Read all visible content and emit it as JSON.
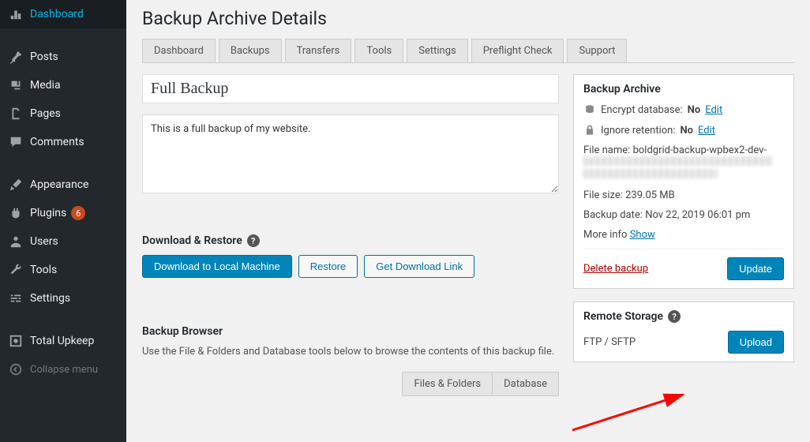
{
  "sidebar": {
    "items": [
      {
        "label": "Dashboard",
        "icon": "dashboard"
      },
      {
        "label": "Posts",
        "icon": "pin"
      },
      {
        "label": "Media",
        "icon": "media"
      },
      {
        "label": "Pages",
        "icon": "pages"
      },
      {
        "label": "Comments",
        "icon": "comment"
      },
      {
        "label": "Appearance",
        "icon": "brush"
      },
      {
        "label": "Plugins",
        "icon": "plug",
        "badge": "6"
      },
      {
        "label": "Users",
        "icon": "user"
      },
      {
        "label": "Tools",
        "icon": "wrench"
      },
      {
        "label": "Settings",
        "icon": "sliders"
      },
      {
        "label": "Total Upkeep",
        "icon": "backup"
      }
    ],
    "collapse": "Collapse menu"
  },
  "page": {
    "title": "Backup Archive Details"
  },
  "tabs": [
    "Dashboard",
    "Backups",
    "Transfers",
    "Tools",
    "Settings",
    "Preflight Check",
    "Support"
  ],
  "form": {
    "title_value": "Full Backup",
    "desc_value": "This is a full backup of my website."
  },
  "download_restore": {
    "heading": "Download & Restore",
    "download": "Download to Local Machine",
    "restore": "Restore",
    "getlink": "Get Download Link"
  },
  "browser": {
    "heading": "Backup Browser",
    "subtext": "Use the File & Folders and Database tools below to browse the contents of this backup file.",
    "tab_files": "Files & Folders",
    "tab_db": "Database"
  },
  "archive": {
    "heading": "Backup Archive",
    "encrypt_label": "Encrypt database:",
    "encrypt_value": "No",
    "ignore_label": "Ignore retention:",
    "ignore_value": "No",
    "edit": "Edit",
    "filename_label": "File name:",
    "filename_value": "boldgrid-backup-wpbex2-dev-",
    "filesize_label": "File size:",
    "filesize_value": "239.05 MB",
    "date_label": "Backup date:",
    "date_value": "Nov 22, 2019 06:01 pm",
    "moreinfo": "More info",
    "show": "Show",
    "delete": "Delete backup",
    "update": "Update"
  },
  "remote": {
    "heading": "Remote Storage",
    "protocol": "FTP / SFTP",
    "upload": "Upload"
  }
}
